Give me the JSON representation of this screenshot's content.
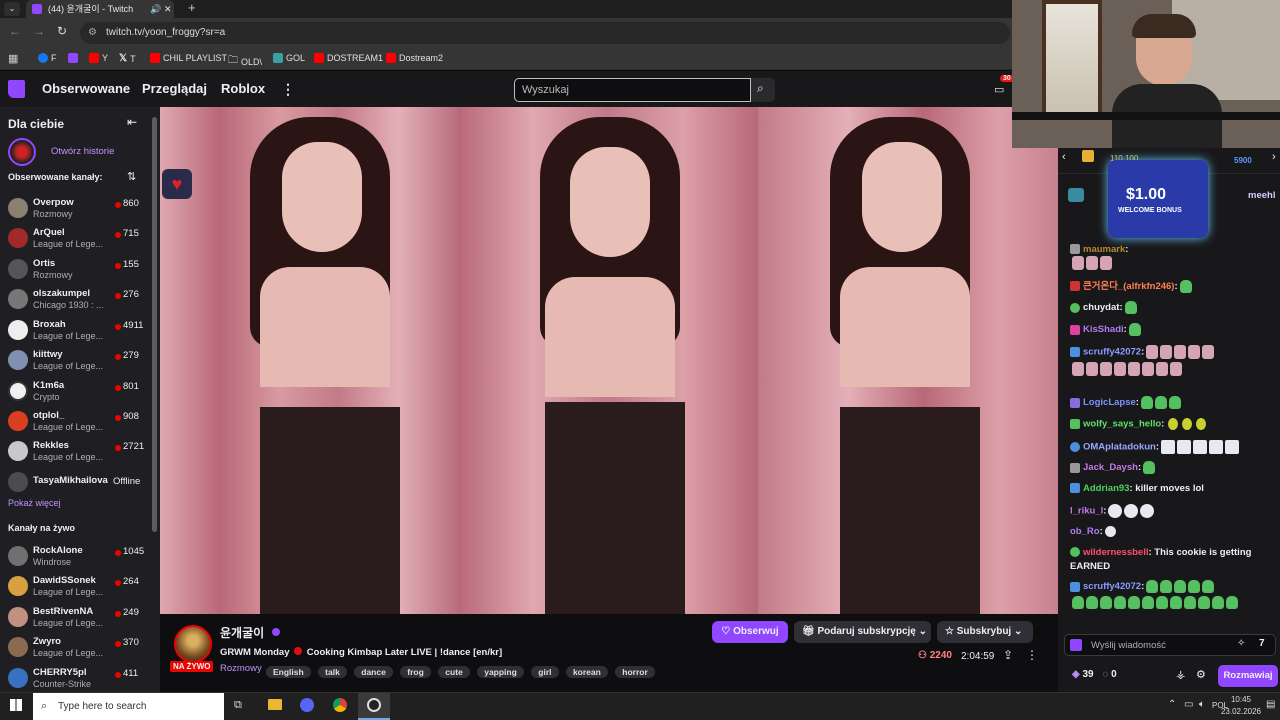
{
  "browser": {
    "tab_title": "(44) 윤개굴이 - Twitch",
    "url": "twitch.tv/yoon_froggy?sr=a",
    "bookmarks": [
      "F",
      "Y",
      "T",
      "CHIL PLAYLIST",
      "OLD\\",
      "GOL",
      "DOSTREAM1",
      "Dostream2"
    ]
  },
  "nav": {
    "following": "Obserwowane",
    "browse": "Przeglądaj",
    "roblox": "Roblox",
    "search_placeholder": "Wyszukaj",
    "notif_count": "30"
  },
  "sidebar": {
    "title": "Dla ciebie",
    "history_link": "Otwórz historie",
    "followed_heading": "Obserwowane kanały:",
    "followed": [
      {
        "name": "Overpow",
        "category": "Rozmowy",
        "viewers": "860"
      },
      {
        "name": "ArQuel",
        "category": "League of Lege...",
        "viewers": "715"
      },
      {
        "name": "Ortis",
        "category": "Rozmowy",
        "viewers": "155"
      },
      {
        "name": "olszakumpel",
        "category": "Chicago 1930 : ...",
        "viewers": "276"
      },
      {
        "name": "Broxah",
        "category": "League of Lege...",
        "viewers": "4911"
      },
      {
        "name": "kiittwy",
        "category": "League of Lege...",
        "viewers": "279"
      },
      {
        "name": "K1m6a",
        "category": "Crypto",
        "viewers": "801"
      },
      {
        "name": "otplol_",
        "category": "League of Lege...",
        "viewers": "908"
      },
      {
        "name": "Rekkles",
        "category": "League of Lege...",
        "viewers": "2721"
      }
    ],
    "offline_channel": {
      "name": "TasyaMikhailova",
      "status": "Offline"
    },
    "show_more": "Pokaż więcej",
    "live_heading": "Kanały na żywo",
    "live": [
      {
        "name": "RockAlone",
        "category": "Windrose",
        "viewers": "1045"
      },
      {
        "name": "DawidSSonek",
        "category": "League of Lege...",
        "viewers": "264"
      },
      {
        "name": "BestRivenNA",
        "category": "League of Lege...",
        "viewers": "249"
      },
      {
        "name": "Zwyro",
        "category": "League of Lege...",
        "viewers": "370"
      },
      {
        "name": "CHERRY5pl",
        "category": "Counter-Strike",
        "viewers": "411"
      }
    ]
  },
  "stream": {
    "channel": "윤개굴이",
    "title_a": "GRWM Monday",
    "title_b": "Cooking Kimbap Later LIVE | !dance [en/kr]",
    "live_badge": "NA ŻYWO",
    "category": "Rozmowy",
    "tags": [
      "English",
      "talk",
      "dance",
      "frog",
      "cute",
      "yapping",
      "girl",
      "korean",
      "horror"
    ],
    "follow": "Obserwuj",
    "gift": "Podaruj subskrypcję",
    "subscribe": "Subskrybuj",
    "viewers": "2240",
    "uptime": "2:04:59"
  },
  "chat": {
    "top_points": "110 100",
    "top_right_points": "5900",
    "overlay_amount": "$1.00",
    "overlay_text": "WELCOME BONUS",
    "right_name": "meehl",
    "messages": [
      {
        "user": "maumark",
        "text": "",
        "color": "#b58a2a"
      },
      {
        "user": "큰거온다_(alfrkfn246)",
        "text": "",
        "color": "#ff7f50"
      },
      {
        "user": "chuydat",
        "text": "",
        "color": "#efeff1"
      },
      {
        "user": "KisShadi",
        "text": "",
        "color": "#b47bf0"
      },
      {
        "user": "scruffy42072",
        "text": "",
        "color": "#8a9bff"
      },
      {
        "user": "LogicLapse",
        "text": "",
        "color": "#7d92ff"
      },
      {
        "user": "wolfy_says_hello",
        "text": "",
        "color": "#62e06b"
      },
      {
        "user": "OMAplatadokun",
        "text": "",
        "color": "#9aa7ff"
      },
      {
        "user": "Jack_Daysh",
        "text": "",
        "color": "#c27ce6"
      },
      {
        "user": "Addrian93",
        "text": "killer moves lol",
        "color": "#49d35a"
      },
      {
        "user": "l_riku_l",
        "text": "",
        "color": "#c27ce6"
      },
      {
        "user": "ob_Ro",
        "text": "",
        "color": "#b47bf0"
      },
      {
        "user": "wildernessbell",
        "text": "This cookie is getting EARNED",
        "color": "#ff4f6b"
      },
      {
        "user": "scruffy42072",
        "text": "",
        "color": "#8a9bff"
      }
    ],
    "input_placeholder": "Wyślij wiadomość",
    "points": "39",
    "bits": "0",
    "chat_button": "Rozmawiaj"
  },
  "taskbar": {
    "search_placeholder": "Type here to search",
    "lang": "POL",
    "time": "10:45",
    "date": "23.02.2026"
  }
}
